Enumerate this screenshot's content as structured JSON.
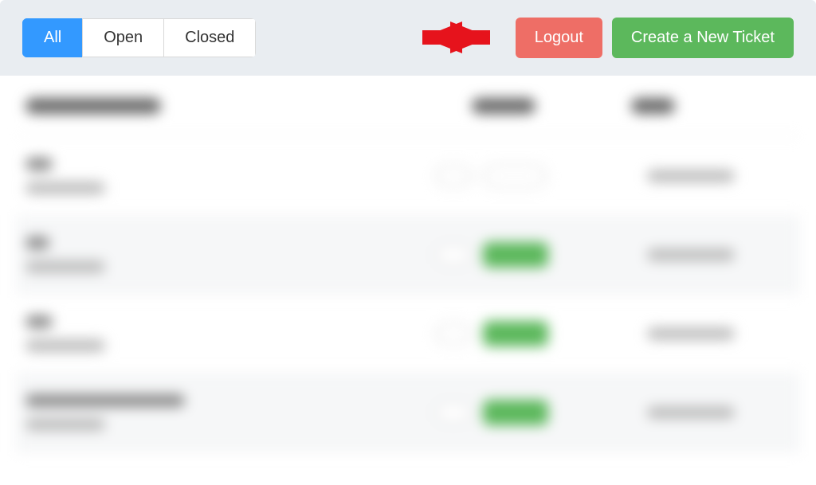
{
  "toolbar": {
    "filters": {
      "all": "All",
      "open": "Open",
      "closed": "Closed"
    },
    "logout": "Logout",
    "create": "Create a New Ticket"
  },
  "annotation": {
    "arrow_color": "#e6131c"
  },
  "table": {
    "headers": {
      "conversation_width": 170,
      "status_width": 80,
      "date_width": 55
    },
    "rows": [
      {
        "alt": false,
        "status_type": "outline"
      },
      {
        "alt": true,
        "status_type": "green"
      },
      {
        "alt": false,
        "status_type": "green"
      },
      {
        "alt": true,
        "status_type": "green"
      }
    ]
  }
}
